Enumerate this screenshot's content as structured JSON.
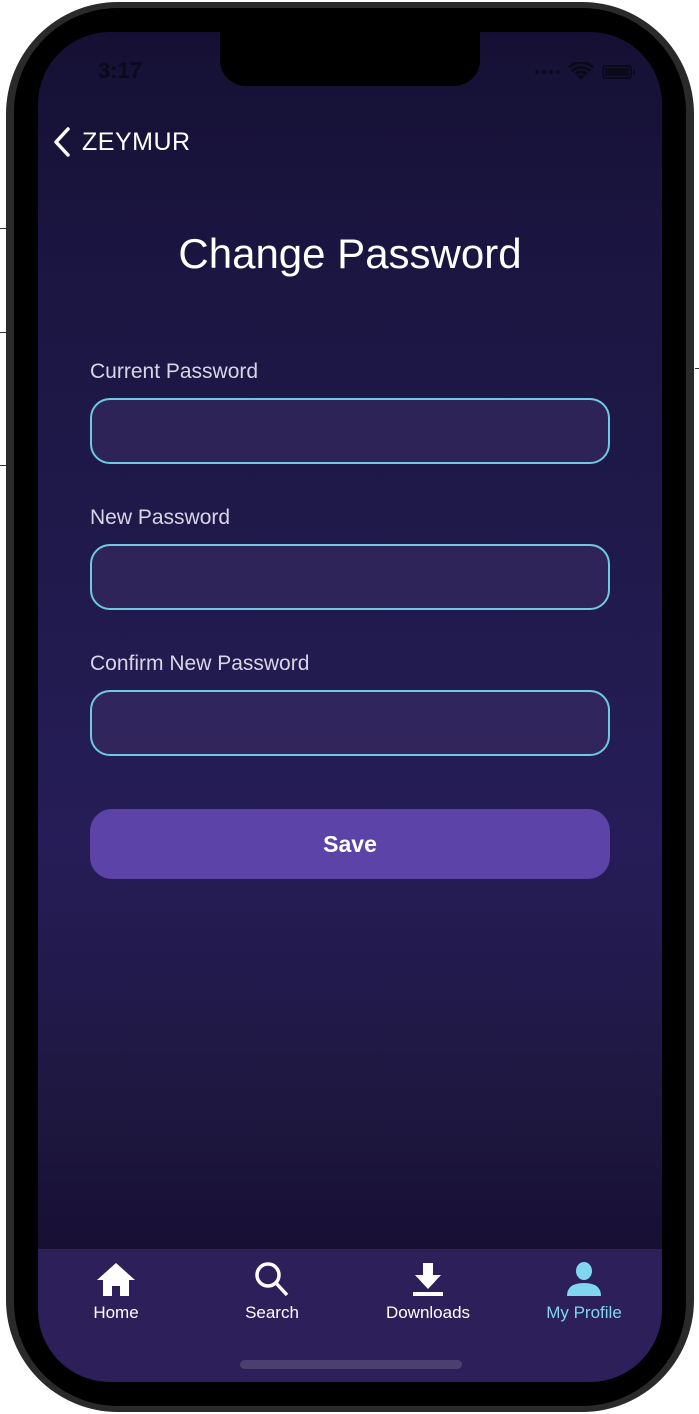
{
  "status_bar": {
    "time": "3:17"
  },
  "nav": {
    "back_label": "ZEYMUR",
    "back_icon": "chevron-left-icon"
  },
  "page": {
    "title": "Change Password"
  },
  "form": {
    "fields": [
      {
        "label": "Current Password",
        "value": "",
        "placeholder": ""
      },
      {
        "label": "New Password",
        "value": "",
        "placeholder": ""
      },
      {
        "label": "Confirm New Password",
        "value": "",
        "placeholder": ""
      }
    ],
    "save_label": "Save"
  },
  "tabbar": {
    "items": [
      {
        "label": "Home",
        "icon": "home-icon",
        "active": false
      },
      {
        "label": "Search",
        "icon": "search-icon",
        "active": false
      },
      {
        "label": "Downloads",
        "icon": "download-icon",
        "active": false
      },
      {
        "label": "My Profile",
        "icon": "profile-icon",
        "active": true
      }
    ]
  },
  "colors": {
    "accent": "#7fd6ee",
    "button": "#5c43a8",
    "input_border": "#6fc9e0",
    "tabbar_bg": "#2c1f5a",
    "background_top": "#151033",
    "background_mid": "#261d58"
  }
}
